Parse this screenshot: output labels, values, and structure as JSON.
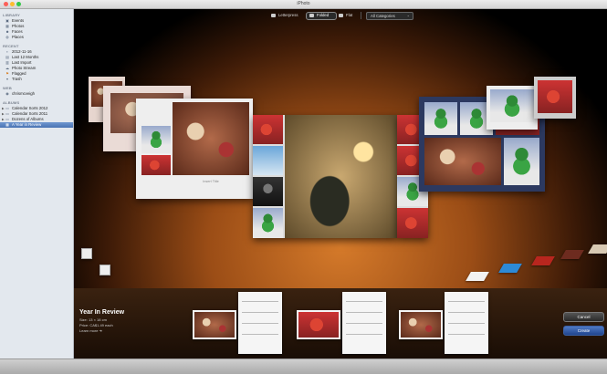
{
  "window": {
    "title": "iPhoto"
  },
  "sidebar": {
    "sections": [
      {
        "title": "LIBRARY",
        "items": [
          {
            "label": "Events",
            "icon": "events-icon"
          },
          {
            "label": "Photos",
            "icon": "photos-icon"
          },
          {
            "label": "Faces",
            "icon": "faces-icon"
          },
          {
            "label": "Places",
            "icon": "places-icon"
          }
        ]
      },
      {
        "title": "RECENT",
        "items": [
          {
            "label": "2012-11-16",
            "icon": "event-icon"
          },
          {
            "label": "Last 12 Months",
            "icon": "calendar-icon"
          },
          {
            "label": "Last Import",
            "icon": "import-icon"
          },
          {
            "label": "Photo Stream",
            "icon": "photostream-icon"
          },
          {
            "label": "Flagged",
            "icon": "flag-icon"
          },
          {
            "label": "Trash",
            "icon": "trash-icon"
          }
        ]
      },
      {
        "title": "WEB",
        "items": [
          {
            "label": "chrismcveigh",
            "icon": "web-icon"
          }
        ]
      },
      {
        "title": "ALBUMS",
        "items": [
          {
            "label": "Calendar Sorts 2012",
            "icon": "folder-icon"
          },
          {
            "label": "Calendar Sorts 2011",
            "icon": "folder-icon"
          },
          {
            "label": "Dozens of Albums",
            "icon": "folder-icon"
          },
          {
            "label": "A Year in Review",
            "icon": "album-icon"
          }
        ]
      }
    ]
  },
  "toolbar": {
    "options": [
      "Letterpress",
      "Folded",
      "Flat"
    ],
    "selected": "Folded",
    "category": "All Categories"
  },
  "theme": {
    "title": "Year In Review"
  },
  "card": {
    "placeholder_text": "Insert Title"
  },
  "info": {
    "size": "Size: 13 × 18 cm",
    "price": "Price: CA$1.49 each",
    "learn_more": "Learn more"
  },
  "buttons": {
    "cancel": "Cancel",
    "create": "Create"
  },
  "colors": {
    "swatches": [
      "#f2f2f2",
      "#2d8ad6",
      "#b8261e",
      "#6d2b1f",
      "#d8c9b3",
      "#4a4a4a"
    ]
  }
}
